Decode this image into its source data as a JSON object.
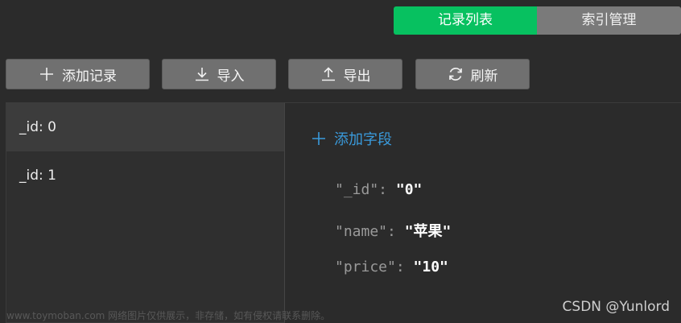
{
  "tabs": {
    "records": "记录列表",
    "indexes": "索引管理"
  },
  "toolbar": {
    "add": "添加记录",
    "import": "导入",
    "export": "导出",
    "refresh": "刷新"
  },
  "icons": {
    "add": "plus-icon",
    "import": "download-icon",
    "export": "upload-icon",
    "refresh": "refresh-icon"
  },
  "records": [
    {
      "label": "_id: 0",
      "selected": true
    },
    {
      "label": "_id: 1",
      "selected": false
    }
  ],
  "detail": {
    "add_field": "添加字段",
    "fields": [
      {
        "key": "\"_id\":",
        "value": "\"0\""
      },
      {
        "key": "\"name\":",
        "value": "\"苹果\""
      },
      {
        "key": "\"price\":",
        "value": "\"10\""
      }
    ]
  },
  "watermark": {
    "left": "www.toymoban.com 网络图片仅供展示，非存储，如有侵权请联系删除。",
    "right": "CSDN @Yunlord"
  },
  "colors": {
    "accent": "#07c160",
    "link": "#3a9bdc"
  }
}
